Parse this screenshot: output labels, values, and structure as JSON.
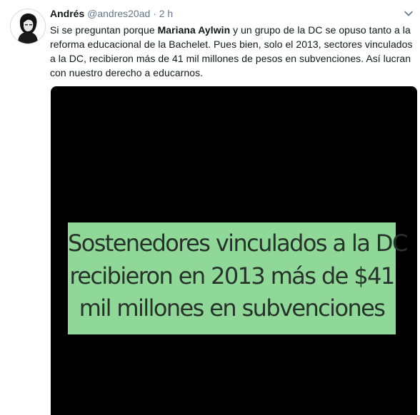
{
  "tweet": {
    "author_name": "Andrés",
    "handle": "@andres20ad",
    "separator": "·",
    "time": "2 h",
    "text_part1": "Si se preguntan porque ",
    "text_bold": "Mariana Aylwin",
    "text_part2": " y un grupo de la DC se opuso tanto a la reforma educacional de la Bachelet. Pues bien, solo el 2013, sectores vinculados a la DC, recibieron más de 41 mil millones de pesos en subvenciones. Así lucran con nuestro derecho a educarnos."
  },
  "media": {
    "background_color": "#000000",
    "banner_color": "#8fd898",
    "banner_lines": [
      "Sostenedores vinculados a la DC",
      "recibieron en 2013 más de $41",
      "mil millones en subvenciones"
    ]
  },
  "icons": {
    "avatar": "avatar-portrait-icon",
    "more": "chevron-down-icon"
  }
}
